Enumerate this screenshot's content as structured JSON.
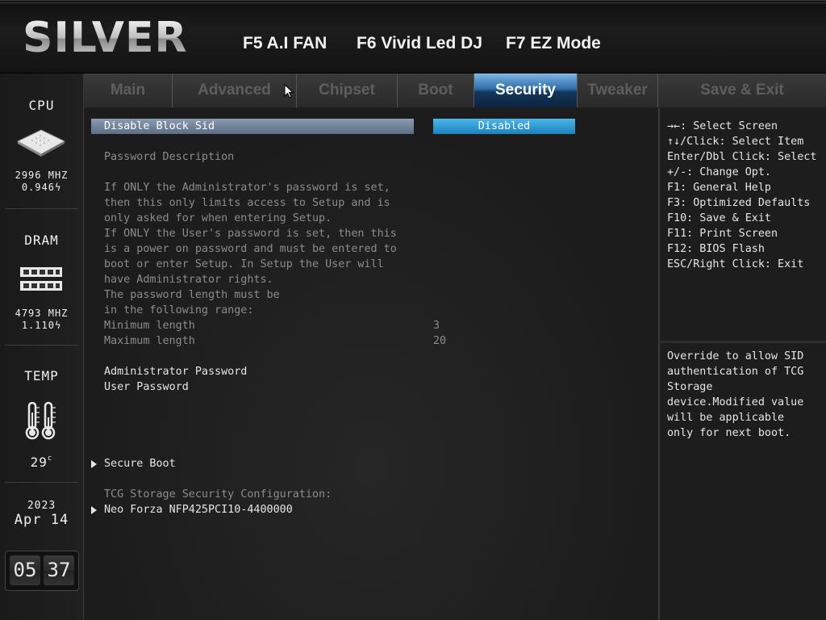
{
  "header": {
    "logo": "SILVER",
    "hotkeys": [
      "F5 A.I FAN",
      "F6 Vivid Led DJ",
      "F7 EZ Mode"
    ]
  },
  "status": {
    "cpu_title": "CPU",
    "cpu_freq": "2996 MHZ",
    "cpu_volt": "0.946",
    "dram_title": "DRAM",
    "dram_freq": "4793 MHZ",
    "dram_volt": "1.110",
    "temp_title": "TEMP",
    "temp_value": "29",
    "temp_unit": "c",
    "year": "2023",
    "date": "Apr 14",
    "hour": "05",
    "minute": "37"
  },
  "tabs": [
    "Main",
    "Advanced",
    "Chipset",
    "Boot",
    "Security",
    "Tweaker",
    "Save & Exit"
  ],
  "active_tab": "Security",
  "main": {
    "selected_item": "Disable Block Sid",
    "selected_value": "Disabled",
    "password_description_label": "Password Description",
    "description_lines": [
      "If ONLY the Administrator's password is set,",
      "then this only limits access to Setup and is",
      "only asked for when entering Setup.",
      "If ONLY the User's password is set, then this",
      "is a power on password and must be entered to",
      "boot or enter Setup. In Setup the User will",
      "have Administrator rights.",
      "The password length must be",
      "in the following range:"
    ],
    "min_label": "Minimum length",
    "min_value": "3",
    "max_label": "Maximum length",
    "max_value": "20",
    "admin_password": "Administrator Password",
    "user_password": "User Password",
    "secure_boot": "Secure Boot",
    "tcg_label": "TCG Storage Security Configuration:",
    "tcg_device": "Neo Forza NFP425PCI10-4400000"
  },
  "help": {
    "keys": [
      "→←: Select Screen",
      "↑↓/Click: Select Item",
      "Enter/Dbl Click: Select",
      "+/-: Change Opt.",
      "F1: General Help",
      "F3: Optimized Defaults",
      "F10: Save & Exit",
      "F11: Print Screen",
      "F12: BIOS Flash",
      "ESC/Right Click: Exit"
    ],
    "description_lines": [
      "Override to allow SID",
      "authentication of TCG",
      "Storage",
      "device.Modified value",
      "will be applicable",
      "only for next boot."
    ]
  },
  "colors": {
    "active_tab": "#2f6fa9",
    "value_box": "#1c83bd",
    "selection_bar": "#5d6f86"
  }
}
